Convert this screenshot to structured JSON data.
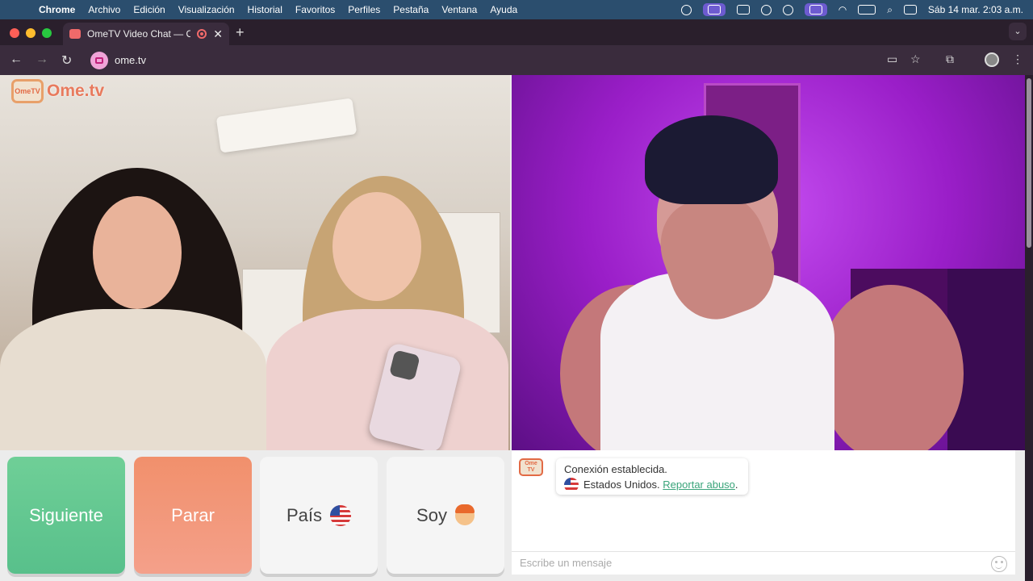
{
  "menubar": {
    "app": "Chrome",
    "items": [
      "Archivo",
      "Edición",
      "Visualización",
      "Historial",
      "Favoritos",
      "Perfiles",
      "Pestaña",
      "Ventana",
      "Ayuda"
    ],
    "datetime": "Sáb 14 mar.  2:03 a.m."
  },
  "browser": {
    "tab_title": "OmeTV Video Chat — Ome",
    "url": "ome.tv"
  },
  "site": {
    "logo_badge_top": "Ome",
    "logo_badge_bottom": "TV",
    "logo_word": "Ome.tv"
  },
  "controls": {
    "next_label": "Siguiente",
    "stop_label": "Parar",
    "country_label": "País",
    "gender_label": "Soy"
  },
  "chat": {
    "line1": "Conexión establecida.",
    "country_text": "Estados Unidos.",
    "report_link": "Reportar abuso",
    "report_suffix": ".",
    "input_placeholder": "Escribe un mensaje"
  },
  "colors": {
    "next": "#58c08b",
    "stop": "#f1906c",
    "accent_link": "#3aa47a",
    "brand": "#e26a45"
  }
}
